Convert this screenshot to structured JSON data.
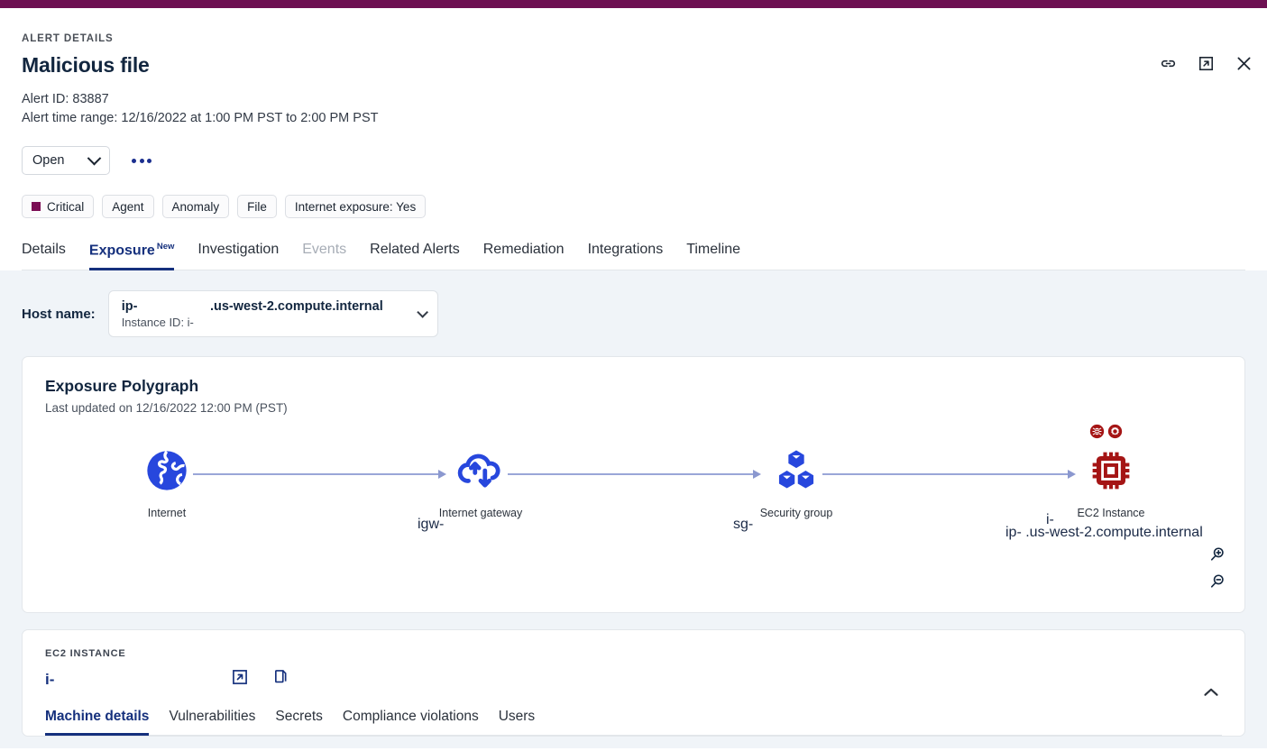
{
  "theme": {
    "brand_bar": "#6d1052",
    "accent": "#15307d",
    "severity_critical": "#7b0d54",
    "node_blue": "#2747dd",
    "node_red": "#a51515"
  },
  "header": {
    "eyebrow": "ALERT DETAILS",
    "title": "Malicious file",
    "alert_id": "Alert ID: 83887",
    "time_range": "Alert time range: 12/16/2022 at 1:00 PM PST to 2:00 PM PST",
    "icons": {
      "link": "link-icon",
      "open_new": "open-in-new-icon",
      "close": "close-icon"
    }
  },
  "status": {
    "value": "Open",
    "more_label": "more-actions"
  },
  "tags": [
    {
      "label": "Critical",
      "has_dot": true
    },
    {
      "label": "Agent",
      "has_dot": false
    },
    {
      "label": "Anomaly",
      "has_dot": false
    },
    {
      "label": "File",
      "has_dot": false
    },
    {
      "label": "Internet exposure: Yes",
      "has_dot": false
    }
  ],
  "tabs": [
    {
      "label": "Details",
      "state": "normal"
    },
    {
      "label": "Exposure",
      "state": "active",
      "badge": "New"
    },
    {
      "label": "Investigation",
      "state": "normal"
    },
    {
      "label": "Events",
      "state": "disabled"
    },
    {
      "label": "Related Alerts",
      "state": "normal"
    },
    {
      "label": "Remediation",
      "state": "normal"
    },
    {
      "label": "Integrations",
      "state": "normal"
    },
    {
      "label": "Timeline",
      "state": "normal"
    }
  ],
  "host": {
    "label": "Host name:",
    "name": "ip-                    .us-west-2.compute.internal",
    "instance_id": "Instance ID: i-"
  },
  "polygraph": {
    "title": "Exposure Polygraph",
    "subtitle": "Last updated on 12/16/2022 12:00 PM (PST)",
    "nodes": [
      {
        "id": "internet",
        "label": "Internet",
        "sub": "",
        "icon": "globe-icon",
        "color": "blue"
      },
      {
        "id": "igw",
        "label": "Internet gateway",
        "sub": "igw-",
        "icon": "internet-gateway-icon",
        "color": "blue"
      },
      {
        "id": "sg",
        "label": "Security group",
        "sub": "sg-",
        "icon": "security-group-icon",
        "color": "blue"
      },
      {
        "id": "ec2",
        "label": "EC2 Instance",
        "sub": "i-",
        "sub2": "ip-                    .us-west-2.compute.internal",
        "icon": "ec2-instance-icon",
        "color": "red"
      }
    ],
    "badges": [
      "vulnerability-bug-icon",
      "misconfiguration-gear-icon"
    ],
    "zoom_controls": [
      "zoom-in-icon",
      "zoom-out-icon"
    ]
  },
  "ec2_panel": {
    "eyebrow": "EC2 INSTANCE",
    "id": "i-",
    "actions": [
      "open-in-new-icon",
      "copy-icon"
    ],
    "collapse": "chevron-up-icon",
    "tabs": [
      {
        "label": "Machine details",
        "state": "active"
      },
      {
        "label": "Vulnerabilities",
        "state": "normal"
      },
      {
        "label": "Secrets",
        "state": "normal"
      },
      {
        "label": "Compliance violations",
        "state": "normal"
      },
      {
        "label": "Users",
        "state": "normal"
      }
    ]
  }
}
